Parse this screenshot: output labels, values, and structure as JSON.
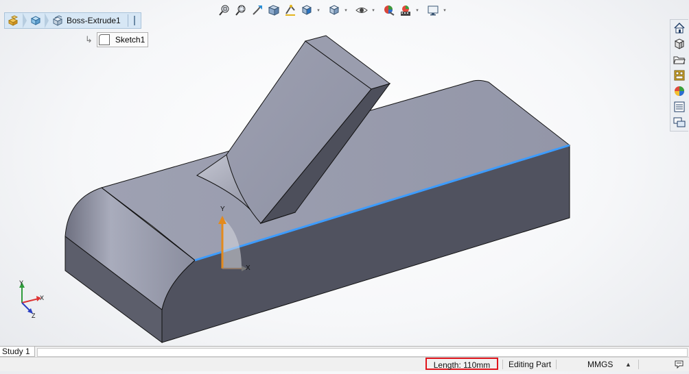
{
  "breadcrumb": {
    "items": [
      {
        "icon": "assembly-icon"
      },
      {
        "icon": "part-icon"
      },
      {
        "icon": "feature-tree-icon",
        "label": "Boss-Extrude1"
      }
    ]
  },
  "sub_item": {
    "label": "Sketch1",
    "icon": "sketch-icon"
  },
  "toolbar": {
    "icons": [
      "zoom-to-fit-icon",
      "zoom-to-area-icon",
      "previous-view-icon",
      "section-view-icon",
      "dynamic-annotation-icon",
      "view-orientation-icon",
      "display-style-icon",
      "hide-show-items-icon",
      "edit-appearance-icon",
      "apply-scene-icon",
      "view-settings-icon"
    ]
  },
  "taskpane": {
    "icons": [
      "home-icon",
      "design-library-icon",
      "file-explorer-icon",
      "view-palette-icon",
      "appearances-icon",
      "custom-properties-icon",
      "forum-icon"
    ]
  },
  "triad": {
    "x_label": "X",
    "y_label": "Y",
    "z_label": "Z"
  },
  "origin": {
    "x_label": "X",
    "y_label": "Y"
  },
  "tabs": {
    "study": "Study 1"
  },
  "status": {
    "length": "Length: 110mm",
    "mode": "Editing Part",
    "units": "MMGS",
    "caret": "▲"
  },
  "colors": {
    "model_top": "#9b9eae",
    "model_front": "#50525f",
    "selection_edge": "#3d9cff",
    "highlight_box": "#e0141b"
  }
}
